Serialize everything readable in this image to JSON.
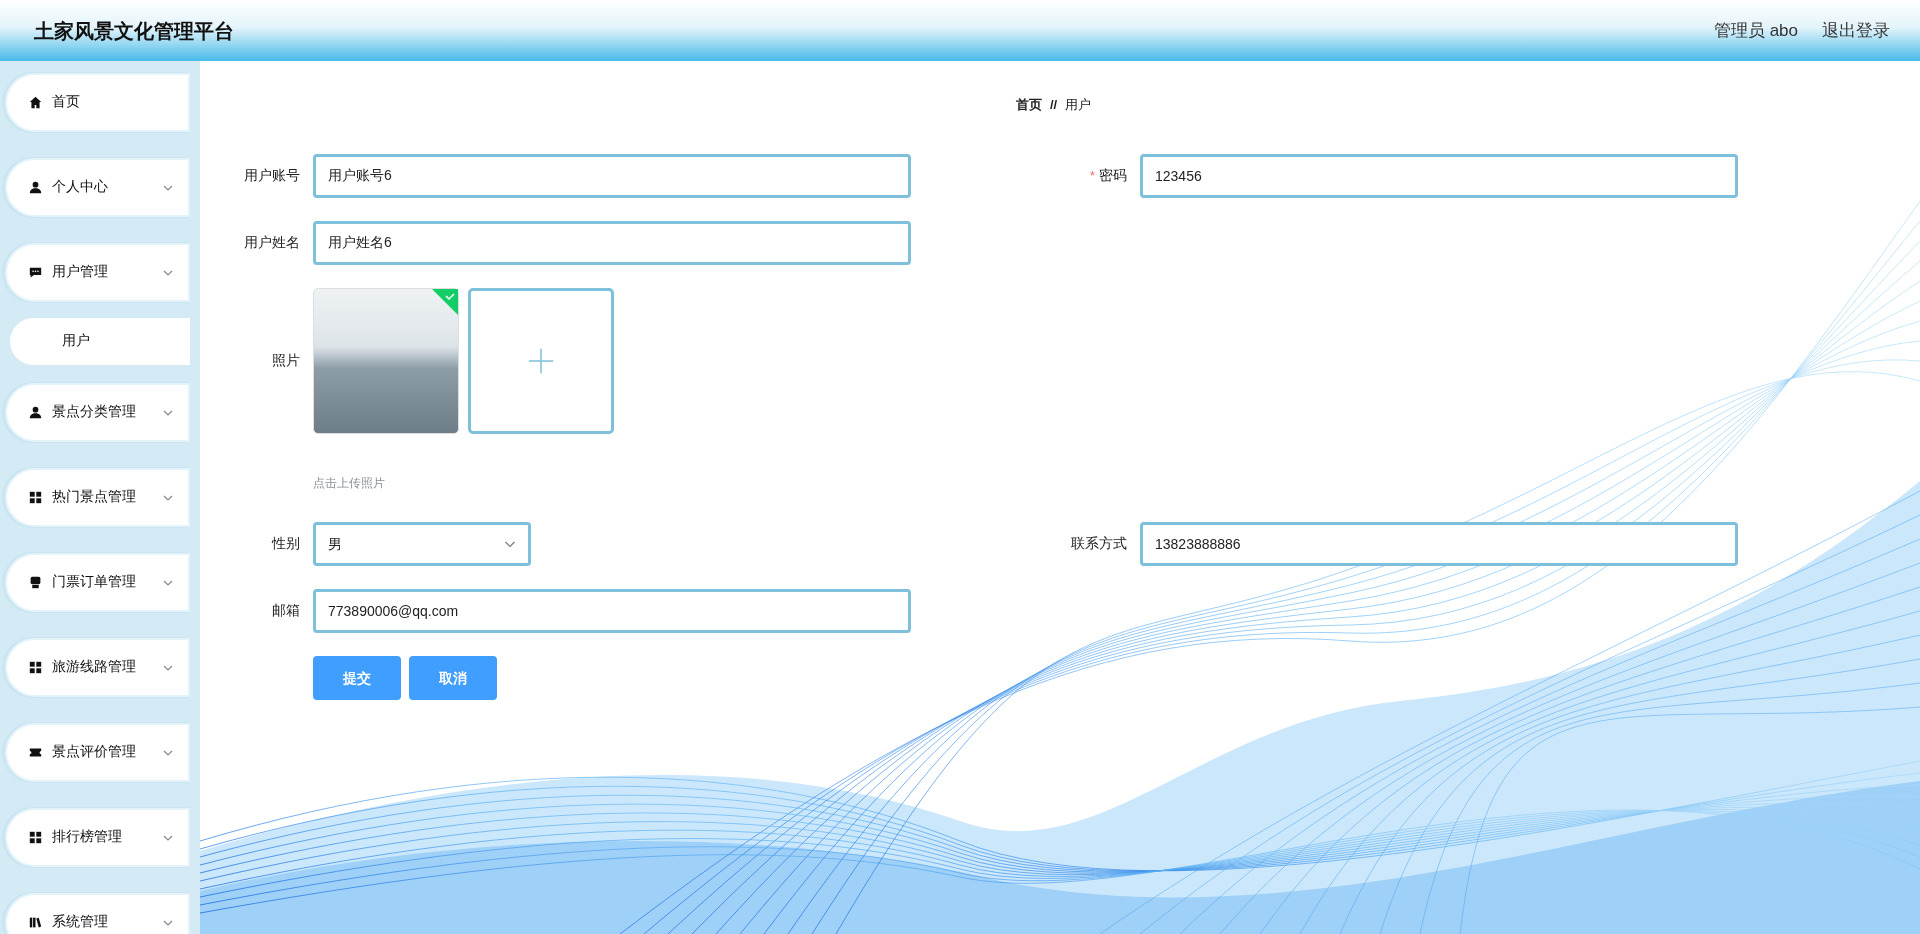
{
  "header": {
    "title": "土家风景文化管理平台",
    "user": "管理员 abo",
    "logout": "退出登录"
  },
  "sidebar": {
    "items": [
      {
        "label": "首页",
        "kind": "link"
      },
      {
        "label": "个人中心",
        "kind": "submenu"
      },
      {
        "label": "用户管理",
        "kind": "submenu",
        "children": [
          {
            "label": "用户",
            "kind": "link"
          }
        ]
      },
      {
        "label": "景点分类管理",
        "kind": "submenu"
      },
      {
        "label": "热门景点管理",
        "kind": "submenu"
      },
      {
        "label": "门票订单管理",
        "kind": "submenu"
      },
      {
        "label": "旅游线路管理",
        "kind": "submenu"
      },
      {
        "label": "景点评价管理",
        "kind": "submenu"
      },
      {
        "label": "排行榜管理",
        "kind": "submenu"
      },
      {
        "label": "系统管理",
        "kind": "submenu"
      }
    ]
  },
  "breadcrumb": {
    "separator": "//",
    "items": [
      {
        "label": "首页"
      },
      {
        "label": "用户"
      }
    ]
  },
  "form": {
    "required_mark": "*",
    "rows": [
      [
        {
          "kind": "text",
          "label": "用户账号",
          "value": "用户账号6",
          "required": false
        },
        {
          "kind": "text",
          "label": "密码",
          "value": "123456",
          "required": true
        }
      ],
      [
        {
          "kind": "text",
          "label": "用户姓名",
          "value": "用户姓名6",
          "required": false
        }
      ],
      [
        {
          "kind": "upload",
          "label": "照片",
          "hint": "点击上传照片",
          "uploaded": true,
          "required": false
        }
      ],
      [
        {
          "kind": "select",
          "label": "性别",
          "value": "男",
          "required": false
        },
        {
          "kind": "text",
          "label": "联系方式",
          "value": "13823888886",
          "required": false
        }
      ],
      [
        {
          "kind": "text",
          "label": "邮箱",
          "value": "773890006@qq.com",
          "required": false
        }
      ]
    ],
    "buttons": [
      {
        "label": "提交"
      },
      {
        "label": "取消"
      }
    ]
  }
}
